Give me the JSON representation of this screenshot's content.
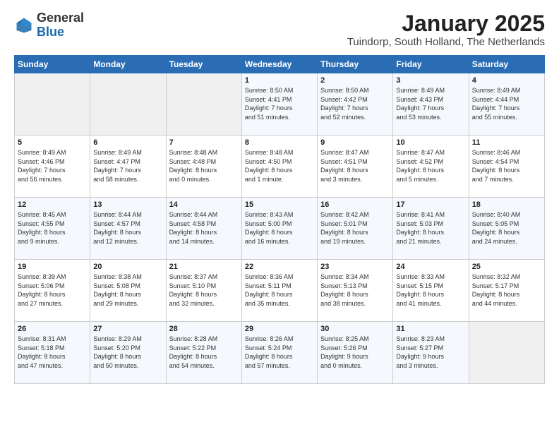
{
  "header": {
    "logo_general": "General",
    "logo_blue": "Blue",
    "month_title": "January 2025",
    "location": "Tuindorp, South Holland, The Netherlands"
  },
  "weekdays": [
    "Sunday",
    "Monday",
    "Tuesday",
    "Wednesday",
    "Thursday",
    "Friday",
    "Saturday"
  ],
  "weeks": [
    [
      {
        "day": "",
        "info": ""
      },
      {
        "day": "",
        "info": ""
      },
      {
        "day": "",
        "info": ""
      },
      {
        "day": "1",
        "info": "Sunrise: 8:50 AM\nSunset: 4:41 PM\nDaylight: 7 hours\nand 51 minutes."
      },
      {
        "day": "2",
        "info": "Sunrise: 8:50 AM\nSunset: 4:42 PM\nDaylight: 7 hours\nand 52 minutes."
      },
      {
        "day": "3",
        "info": "Sunrise: 8:49 AM\nSunset: 4:43 PM\nDaylight: 7 hours\nand 53 minutes."
      },
      {
        "day": "4",
        "info": "Sunrise: 8:49 AM\nSunset: 4:44 PM\nDaylight: 7 hours\nand 55 minutes."
      }
    ],
    [
      {
        "day": "5",
        "info": "Sunrise: 8:49 AM\nSunset: 4:46 PM\nDaylight: 7 hours\nand 56 minutes."
      },
      {
        "day": "6",
        "info": "Sunrise: 8:49 AM\nSunset: 4:47 PM\nDaylight: 7 hours\nand 58 minutes."
      },
      {
        "day": "7",
        "info": "Sunrise: 8:48 AM\nSunset: 4:48 PM\nDaylight: 8 hours\nand 0 minutes."
      },
      {
        "day": "8",
        "info": "Sunrise: 8:48 AM\nSunset: 4:50 PM\nDaylight: 8 hours\nand 1 minute."
      },
      {
        "day": "9",
        "info": "Sunrise: 8:47 AM\nSunset: 4:51 PM\nDaylight: 8 hours\nand 3 minutes."
      },
      {
        "day": "10",
        "info": "Sunrise: 8:47 AM\nSunset: 4:52 PM\nDaylight: 8 hours\nand 5 minutes."
      },
      {
        "day": "11",
        "info": "Sunrise: 8:46 AM\nSunset: 4:54 PM\nDaylight: 8 hours\nand 7 minutes."
      }
    ],
    [
      {
        "day": "12",
        "info": "Sunrise: 8:45 AM\nSunset: 4:55 PM\nDaylight: 8 hours\nand 9 minutes."
      },
      {
        "day": "13",
        "info": "Sunrise: 8:44 AM\nSunset: 4:57 PM\nDaylight: 8 hours\nand 12 minutes."
      },
      {
        "day": "14",
        "info": "Sunrise: 8:44 AM\nSunset: 4:58 PM\nDaylight: 8 hours\nand 14 minutes."
      },
      {
        "day": "15",
        "info": "Sunrise: 8:43 AM\nSunset: 5:00 PM\nDaylight: 8 hours\nand 16 minutes."
      },
      {
        "day": "16",
        "info": "Sunrise: 8:42 AM\nSunset: 5:01 PM\nDaylight: 8 hours\nand 19 minutes."
      },
      {
        "day": "17",
        "info": "Sunrise: 8:41 AM\nSunset: 5:03 PM\nDaylight: 8 hours\nand 21 minutes."
      },
      {
        "day": "18",
        "info": "Sunrise: 8:40 AM\nSunset: 5:05 PM\nDaylight: 8 hours\nand 24 minutes."
      }
    ],
    [
      {
        "day": "19",
        "info": "Sunrise: 8:39 AM\nSunset: 5:06 PM\nDaylight: 8 hours\nand 27 minutes."
      },
      {
        "day": "20",
        "info": "Sunrise: 8:38 AM\nSunset: 5:08 PM\nDaylight: 8 hours\nand 29 minutes."
      },
      {
        "day": "21",
        "info": "Sunrise: 8:37 AM\nSunset: 5:10 PM\nDaylight: 8 hours\nand 32 minutes."
      },
      {
        "day": "22",
        "info": "Sunrise: 8:36 AM\nSunset: 5:11 PM\nDaylight: 8 hours\nand 35 minutes."
      },
      {
        "day": "23",
        "info": "Sunrise: 8:34 AM\nSunset: 5:13 PM\nDaylight: 8 hours\nand 38 minutes."
      },
      {
        "day": "24",
        "info": "Sunrise: 8:33 AM\nSunset: 5:15 PM\nDaylight: 8 hours\nand 41 minutes."
      },
      {
        "day": "25",
        "info": "Sunrise: 8:32 AM\nSunset: 5:17 PM\nDaylight: 8 hours\nand 44 minutes."
      }
    ],
    [
      {
        "day": "26",
        "info": "Sunrise: 8:31 AM\nSunset: 5:18 PM\nDaylight: 8 hours\nand 47 minutes."
      },
      {
        "day": "27",
        "info": "Sunrise: 8:29 AM\nSunset: 5:20 PM\nDaylight: 8 hours\nand 50 minutes."
      },
      {
        "day": "28",
        "info": "Sunrise: 8:28 AM\nSunset: 5:22 PM\nDaylight: 8 hours\nand 54 minutes."
      },
      {
        "day": "29",
        "info": "Sunrise: 8:26 AM\nSunset: 5:24 PM\nDaylight: 8 hours\nand 57 minutes."
      },
      {
        "day": "30",
        "info": "Sunrise: 8:25 AM\nSunset: 5:26 PM\nDaylight: 9 hours\nand 0 minutes."
      },
      {
        "day": "31",
        "info": "Sunrise: 8:23 AM\nSunset: 5:27 PM\nDaylight: 9 hours\nand 3 minutes."
      },
      {
        "day": "",
        "info": ""
      }
    ]
  ]
}
